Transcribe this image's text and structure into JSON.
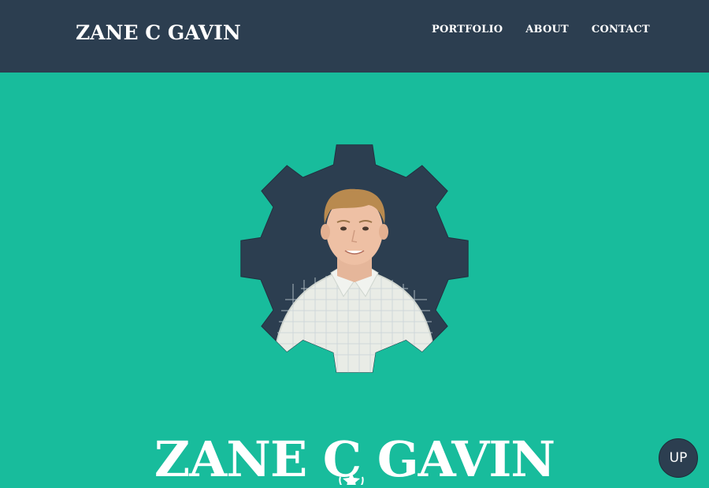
{
  "navbar": {
    "brand": "ZANE C GAVIN",
    "links": [
      "PORTFOLIO",
      "ABOUT",
      "CONTACT"
    ]
  },
  "hero": {
    "name": "ZANE C GAVIN",
    "avatar_icon": "gear-icon",
    "divider_icon": "star-icon"
  },
  "up_button": {
    "label": "UP"
  },
  "colors": {
    "primary": "#2c3e50",
    "accent": "#18bc9c",
    "text": "#ffffff"
  }
}
